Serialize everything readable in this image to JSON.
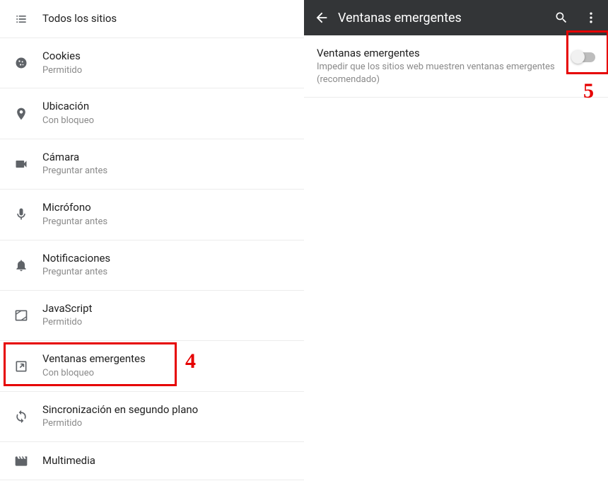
{
  "left": {
    "items": [
      {
        "title": "Todos los sitios",
        "subtitle": ""
      },
      {
        "title": "Cookies",
        "subtitle": "Permitido"
      },
      {
        "title": "Ubicación",
        "subtitle": "Con bloqueo"
      },
      {
        "title": "Cámara",
        "subtitle": "Preguntar antes"
      },
      {
        "title": "Micrófono",
        "subtitle": "Preguntar antes"
      },
      {
        "title": "Notificaciones",
        "subtitle": "Preguntar antes"
      },
      {
        "title": "JavaScript",
        "subtitle": "Permitido"
      },
      {
        "title": "Ventanas emergentes",
        "subtitle": "Con bloqueo"
      },
      {
        "title": "Sincronización en segundo plano",
        "subtitle": "Permitido"
      },
      {
        "title": "Multimedia",
        "subtitle": ""
      }
    ]
  },
  "right": {
    "appbar_title": "Ventanas emergentes",
    "setting_title": "Ventanas emergentes",
    "setting_desc": "Impedir que los sitios web muestren ventanas emergentes (recomendado)"
  },
  "annotations": {
    "callout4": "4",
    "callout5": "5"
  }
}
